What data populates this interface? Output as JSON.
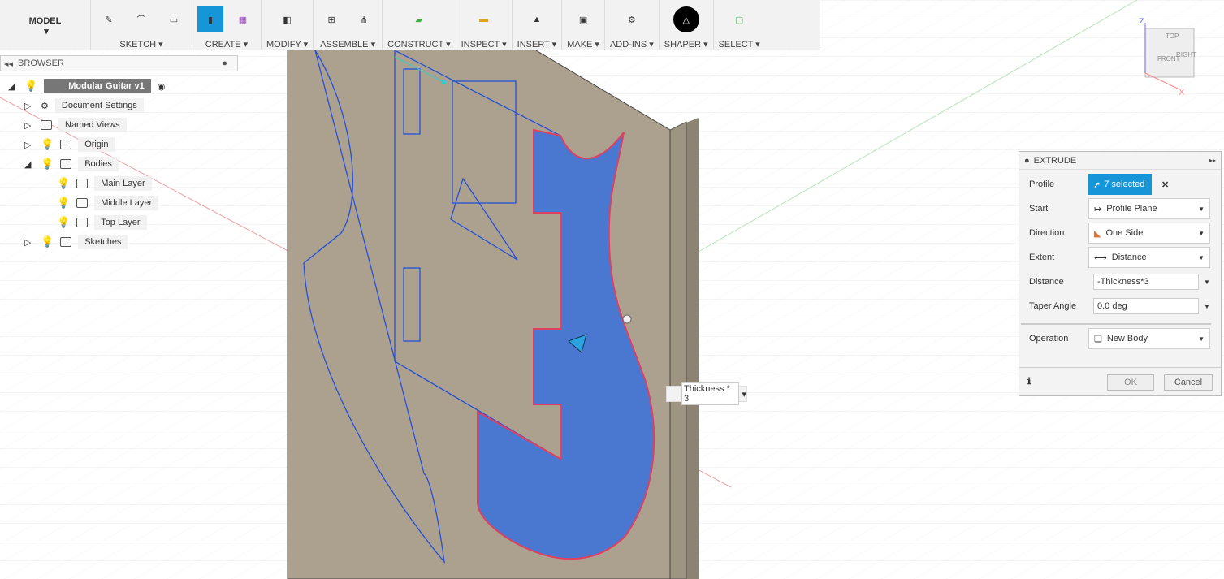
{
  "toolbar": {
    "workspace": "MODEL",
    "groups": [
      {
        "label": "SKETCH",
        "icons": [
          "create-sketch-icon",
          "spline-icon",
          "rectangle-icon"
        ]
      },
      {
        "label": "CREATE",
        "icons": [
          "extrude-icon",
          "form-icon"
        ]
      },
      {
        "label": "MODIFY",
        "icons": [
          "press-pull-icon"
        ]
      },
      {
        "label": "ASSEMBLE",
        "icons": [
          "new-component-icon",
          "joint-icon"
        ]
      },
      {
        "label": "CONSTRUCT",
        "icons": [
          "offset-plane-icon"
        ]
      },
      {
        "label": "INSPECT",
        "icons": [
          "measure-icon"
        ]
      },
      {
        "label": "INSERT",
        "icons": [
          "insert-image-icon"
        ]
      },
      {
        "label": "MAKE",
        "icons": [
          "3d-print-icon"
        ]
      },
      {
        "label": "ADD-INS",
        "icons": [
          "scripts-icon"
        ]
      },
      {
        "label": "SHAPER",
        "icons": [
          "shaper-icon"
        ]
      },
      {
        "label": "SELECT",
        "icons": [
          "select-icon"
        ]
      }
    ]
  },
  "browser": {
    "title": "BROWSER",
    "root": "Modular Guitar v1",
    "items": [
      {
        "label": "Document Settings"
      },
      {
        "label": "Named Views"
      },
      {
        "label": "Origin"
      },
      {
        "label": "Bodies"
      },
      {
        "label": "Main Layer"
      },
      {
        "label": "Middle Layer"
      },
      {
        "label": "Top Layer"
      },
      {
        "label": "Sketches"
      }
    ]
  },
  "viewcube": {
    "top": "TOP",
    "front": "FRONT",
    "right": "RIGHT",
    "z": "Z",
    "x": "X"
  },
  "distance_input": "Thickness * 3",
  "extrude": {
    "title": "EXTRUDE",
    "profile_label": "Profile",
    "profile_value": "7 selected",
    "start_label": "Start",
    "start_value": "Profile Plane",
    "direction_label": "Direction",
    "direction_value": "One Side",
    "extent_label": "Extent",
    "extent_value": "Distance",
    "distance_label": "Distance",
    "distance_value": "-Thickness*3",
    "taper_label": "Taper Angle",
    "taper_value": "0.0 deg",
    "operation_label": "Operation",
    "operation_value": "New Body",
    "ok": "OK",
    "cancel": "Cancel",
    "accent": "#1696d8"
  }
}
